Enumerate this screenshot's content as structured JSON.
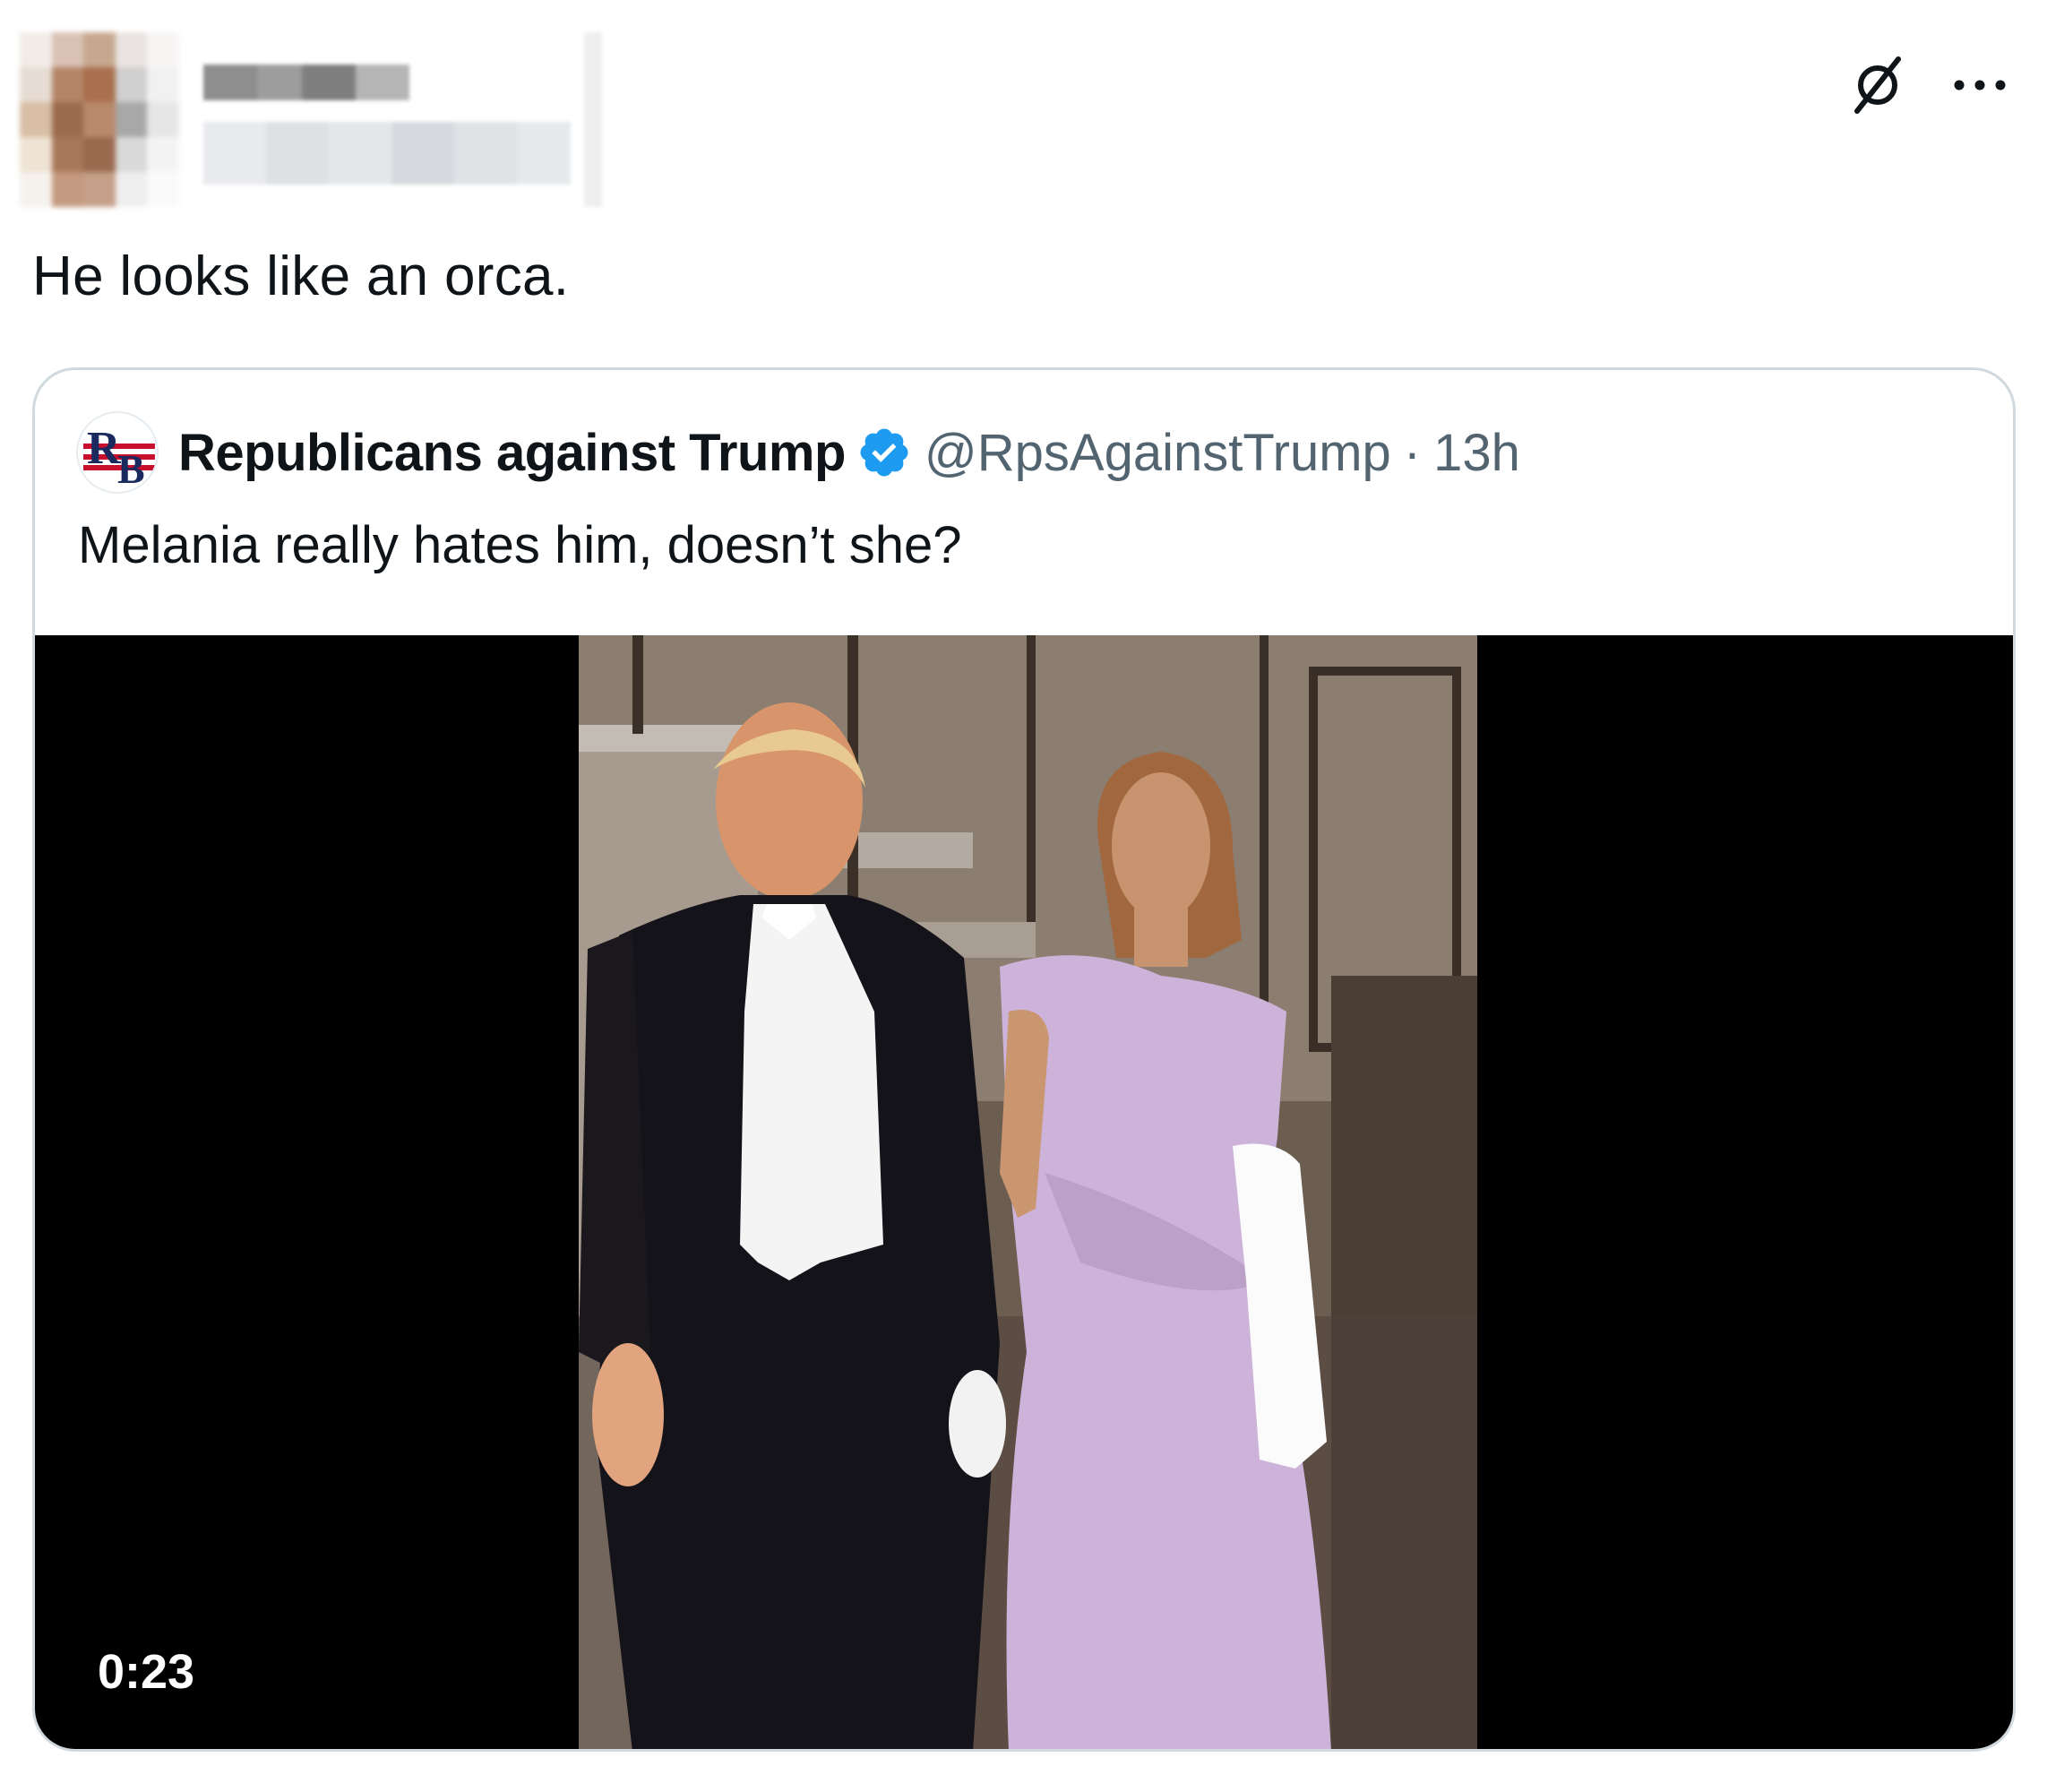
{
  "post": {
    "text": "He looks like an orca."
  },
  "header": {
    "icons": [
      "grok-icon",
      "more-options-icon"
    ]
  },
  "quote": {
    "author_name": "Republicans against Trump",
    "handle": "@RpsAgainstTrump",
    "separator": "·",
    "time": "13h",
    "text": "Melania really hates him, doesn’t she?",
    "avatar_icon": "rb-logo-icon"
  },
  "video": {
    "duration": "0:23"
  },
  "colors": {
    "text_primary": "#0f1419",
    "text_secondary": "#536471",
    "border": "#cfd9de",
    "verified": "#1d9bf0"
  }
}
